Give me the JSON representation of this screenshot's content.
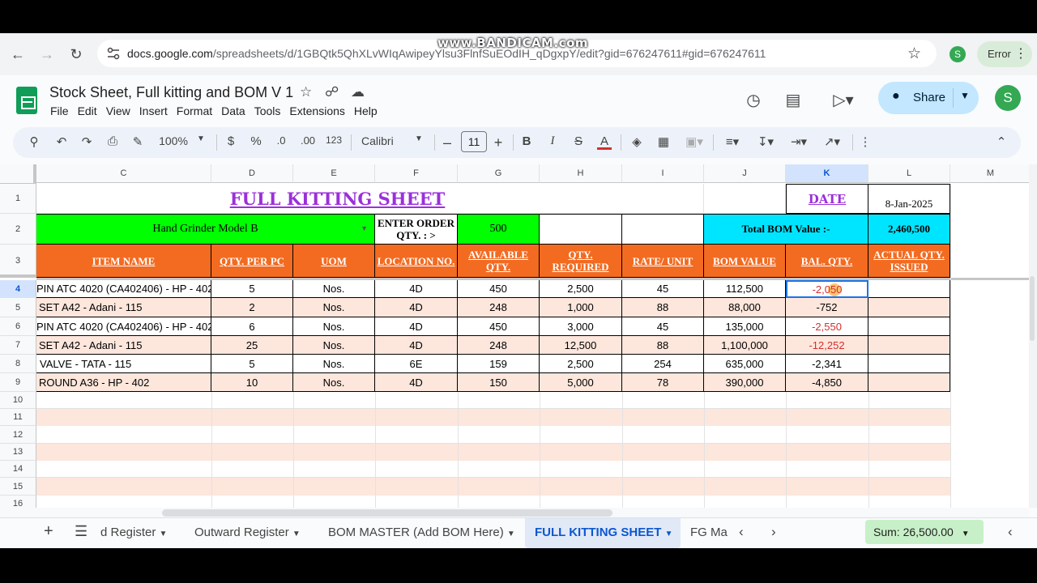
{
  "watermark": "www.BANDICAM.com",
  "browser": {
    "url_host": "docs.google.com",
    "url_path": "/spreadsheets/d/1GBQtk5QhXLvWIqAwipeyYlsu3FlnfSuEOdIH_qDgxpY/edit?gid=676247611#gid=676247611",
    "profile_initial": "S",
    "error_label": "Error"
  },
  "sheets": {
    "title": "Stock Sheet, Full kitting and BOM V 1",
    "menu": [
      "File",
      "Edit",
      "View",
      "Insert",
      "Format",
      "Data",
      "Tools",
      "Extensions",
      "Help"
    ],
    "share_label": "Share",
    "profile_initial": "S"
  },
  "toolbar": {
    "zoom": "100%",
    "currency": "$",
    "percent": "%",
    "dec_decrease": ".0",
    "dec_increase": ".00",
    "number_format": "123",
    "font": "Calibri",
    "font_size": "11",
    "bold": "B",
    "italic": "I",
    "strike": "S",
    "text_color": "A"
  },
  "grid": {
    "columns": [
      "C",
      "D",
      "E",
      "F",
      "G",
      "H",
      "I",
      "J",
      "K",
      "L",
      "M"
    ],
    "rows": [
      "1",
      "2",
      "3",
      "4",
      "5",
      "6",
      "7",
      "8",
      "9",
      "10",
      "11",
      "12",
      "13",
      "14",
      "15",
      "16"
    ],
    "title": "FULL KITTING SHEET",
    "date_label": "DATE",
    "date_value": "8-Jan-2025",
    "model": "Hand Grinder Model B",
    "enter_order_label": "ENTER ORDER QTY. : >",
    "order_qty": "500",
    "total_bom_label": "Total BOM Value :-",
    "total_bom_value": "2,460,500",
    "headers": [
      "ITEM NAME",
      "QTY. PER PC",
      "UOM",
      "LOCATION NO.",
      "AVAILABLE QTY.",
      "QTY. REQUIRED",
      "RATE/ UNIT",
      "BOM VALUE",
      "BAL. QTY.",
      "ACTUAL QTY. ISSUED"
    ],
    "data_rows": [
      [
        "PIN ATC 4020 (CA402406) - HP - 402",
        "5",
        "Nos.",
        "4D",
        "450",
        "2,500",
        "45",
        "112,500",
        "-2,050",
        ""
      ],
      [
        "SET A42 - Adani - 115",
        "2",
        "Nos.",
        "4D",
        "248",
        "1,000",
        "88",
        "88,000",
        "-752",
        ""
      ],
      [
        "PIN ATC 4020 (CA402406) - HP - 402",
        "6",
        "Nos.",
        "4D",
        "450",
        "3,000",
        "45",
        "135,000",
        "-2,550",
        ""
      ],
      [
        "SET A42 - Adani - 115",
        "25",
        "Nos.",
        "4D",
        "248",
        "12,500",
        "88",
        "1,100,000",
        "-12,252",
        ""
      ],
      [
        "VALVE - TATA - 115",
        "5",
        "Nos.",
        "6E",
        "159",
        "2,500",
        "254",
        "635,000",
        "-2,341",
        ""
      ],
      [
        "ROUND A36 - HP - 402",
        "10",
        "Nos.",
        "4D",
        "150",
        "5,000",
        "78",
        "390,000",
        "-4,850",
        ""
      ]
    ]
  },
  "tabs": {
    "items": [
      "d Register",
      "Outward Register",
      "BOM MASTER (Add BOM Here)",
      "FULL KITTING SHEET",
      "FG Ma"
    ],
    "active": "FULL KITTING SHEET",
    "sum": "Sum: 26,500.00"
  }
}
